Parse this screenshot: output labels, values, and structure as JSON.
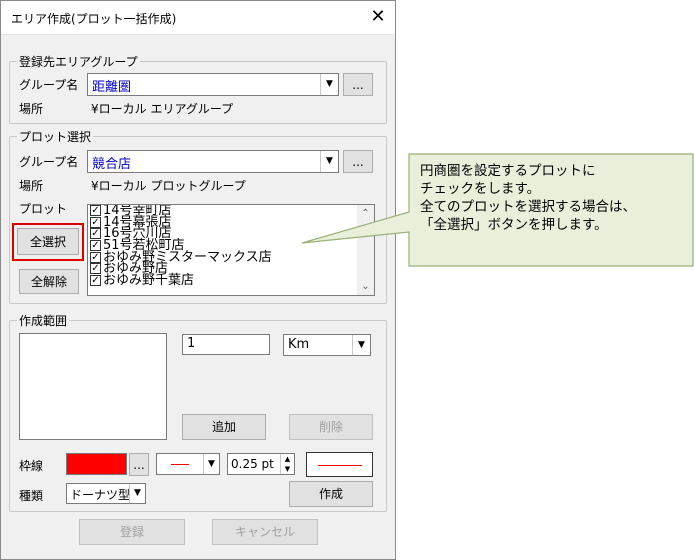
{
  "window": {
    "title": "エリア作成(プロット一括作成)",
    "close_label": "✕"
  },
  "target_group": {
    "legend": "登録先エリアグループ",
    "group_name_label": "グループ名",
    "group_name_value": "距離圏",
    "browse_label": "...",
    "location_label": "場所",
    "location_value": "¥ローカル エリアグループ"
  },
  "plot_select": {
    "legend": "プロット選択",
    "group_name_label": "グループ名",
    "group_name_value": "競合店",
    "browse_label": "...",
    "location_label": "場所",
    "location_value": "¥ローカル プロットグループ",
    "plot_label": "プロット",
    "select_all_label": "全選択",
    "deselect_all_label": "全解除",
    "items": [
      {
        "label": "14号幸町店",
        "checked": true
      },
      {
        "label": "14号幕張店",
        "checked": true
      },
      {
        "label": "16号穴川店",
        "checked": true
      },
      {
        "label": "51号若松町店",
        "checked": true
      },
      {
        "label": "おゆみ野ミスターマックス店",
        "checked": true
      },
      {
        "label": "おゆみ野店",
        "checked": true
      },
      {
        "label": "おゆみ野千葉店",
        "checked": true
      }
    ]
  },
  "range": {
    "legend": "作成範囲",
    "value": "1",
    "unit": "Km",
    "add_label": "追加",
    "delete_label": "削除"
  },
  "style": {
    "frame_label": "枠線",
    "color": "#ff0000",
    "color_browse_label": "...",
    "width_value": "0.25 pt",
    "type_label": "種類",
    "type_value": "ドーナツ型",
    "create_label": "作成"
  },
  "footer": {
    "register_label": "登録",
    "cancel_label": "キャンセル"
  },
  "callout": {
    "lines": [
      "円商圏を設定するプロットに",
      "チェックをします。",
      "全てのプロットを選択する場合は、",
      "「全選択」ボタンを押します。"
    ],
    "fill": "#e8f0dc",
    "stroke": "#9ab07a"
  }
}
